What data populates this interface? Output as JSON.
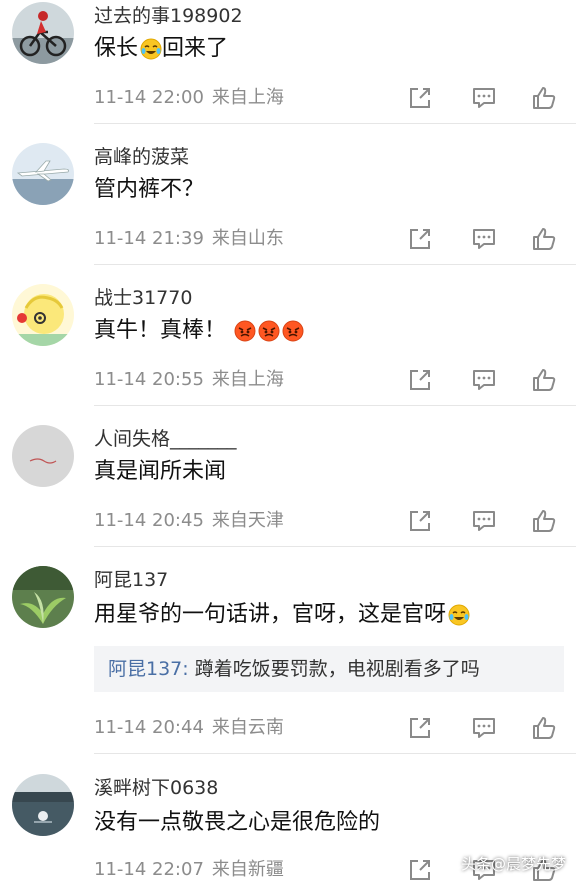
{
  "comments": [
    {
      "username": "过去的事198902",
      "text": "保长",
      "text_after": "回来了",
      "emoji_mid": "laugh-cry",
      "date": "11-14 22:00",
      "location": "来自上海"
    },
    {
      "username": "高峰的菠菜",
      "text": "管内裤不？",
      "date": "11-14 21:39",
      "location": "来自山东"
    },
    {
      "username": "战士31770",
      "text": "真牛！真棒！",
      "emoji_trailing": [
        "angry",
        "angry",
        "angry"
      ],
      "date": "11-14 20:55",
      "location": "来自上海"
    },
    {
      "username": "人间失格_______",
      "text": "真是闻所未闻",
      "date": "11-14 20:45",
      "location": "来自天津"
    },
    {
      "username": "阿昆137",
      "text": "用星爷的一句话讲，官呀，这是官呀",
      "emoji_trailing": [
        "laugh-cry"
      ],
      "reply": {
        "name": "阿昆137:",
        "text": " 蹲着吃饭要罚款，电视剧看多了吗"
      },
      "date": "11-14 20:44",
      "location": "来自云南"
    },
    {
      "username": "溪畔树下0638",
      "text": "没有一点敬畏之心是很危险的",
      "date": "11-14 22:07",
      "location": "来自新疆"
    }
  ],
  "actions": {
    "share_icon": "share-icon",
    "reply_icon": "comment-icon",
    "like_icon": "thumbs-up-icon"
  },
  "watermark": "头条@晨梦先梦",
  "colors": {
    "text": "#111111",
    "meta": "#8c8c8c",
    "icon": "#8a8a8a",
    "reply_name": "#4a6fa5",
    "reply_bg": "#f3f4f6"
  }
}
